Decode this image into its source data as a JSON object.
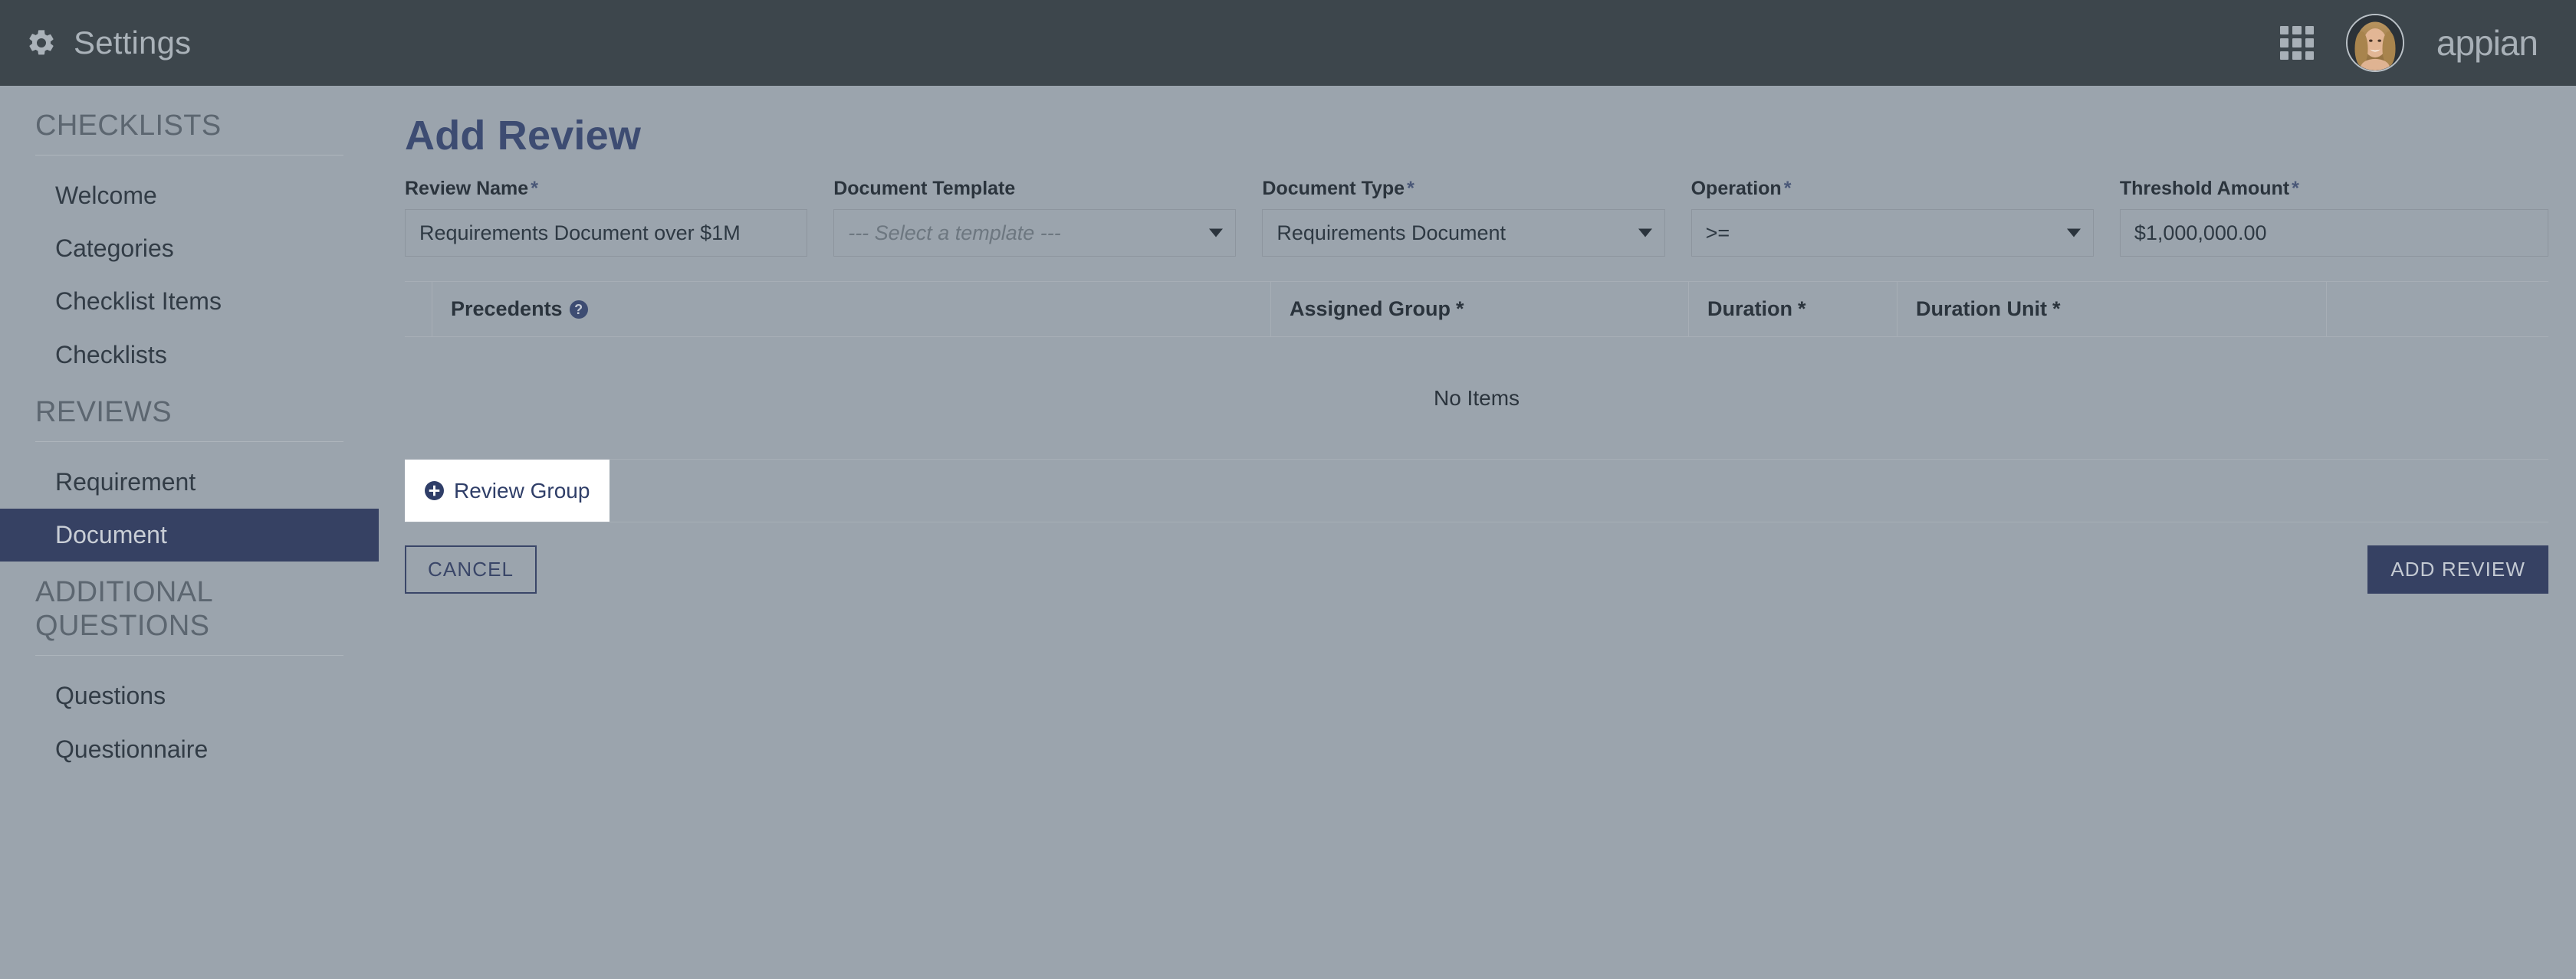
{
  "topbar": {
    "gear_icon": "gear-icon",
    "title": "Settings",
    "apps_icon": "grid-apps-icon",
    "avatar": "user-avatar",
    "brand": "appian"
  },
  "sidebar": {
    "sections": [
      {
        "heading": "CHECKLISTS",
        "items": [
          {
            "label": "Welcome",
            "active": false
          },
          {
            "label": "Categories",
            "active": false
          },
          {
            "label": "Checklist Items",
            "active": false
          },
          {
            "label": "Checklists",
            "active": false
          }
        ]
      },
      {
        "heading": "REVIEWS",
        "items": [
          {
            "label": "Requirement",
            "active": false
          },
          {
            "label": "Document",
            "active": true
          }
        ]
      },
      {
        "heading": "ADDITIONAL QUESTIONS",
        "items": [
          {
            "label": "Questions",
            "active": false
          },
          {
            "label": "Questionnaire",
            "active": false
          }
        ]
      }
    ]
  },
  "main": {
    "page_title": "Add Review",
    "fields": {
      "review_name": {
        "label": "Review Name",
        "required": true,
        "value": "Requirements Document over $1M",
        "type": "text"
      },
      "document_template": {
        "label": "Document Template",
        "required": false,
        "value": "",
        "placeholder": "--- Select a template ---",
        "type": "select"
      },
      "document_type": {
        "label": "Document Type",
        "required": true,
        "value": "Requirements Document",
        "type": "select"
      },
      "operation": {
        "label": "Operation",
        "required": true,
        "value": ">=",
        "type": "select"
      },
      "threshold_amount": {
        "label": "Threshold Amount",
        "required": true,
        "value": "$1,000,000.00",
        "type": "text"
      }
    },
    "grid": {
      "columns": [
        {
          "label": "Precedents",
          "required": false,
          "help": true
        },
        {
          "label": "Assigned Group",
          "required": true,
          "help": false
        },
        {
          "label": "Duration",
          "required": true,
          "help": false
        },
        {
          "label": "Duration Unit",
          "required": true,
          "help": false
        }
      ],
      "empty_text": "No Items",
      "add_row_label": "Review Group",
      "add_row_icon": "plus-circle-icon",
      "help_icon": "question-circle-icon"
    },
    "actions": {
      "cancel_label": "CANCEL",
      "submit_label": "ADD REVIEW"
    }
  },
  "colors": {
    "topbar_bg": "#3d464c",
    "page_bg": "#9ba4ad",
    "accent": "#364163",
    "title": "#3d4c72",
    "sidebar_active_bg": "#364163"
  }
}
